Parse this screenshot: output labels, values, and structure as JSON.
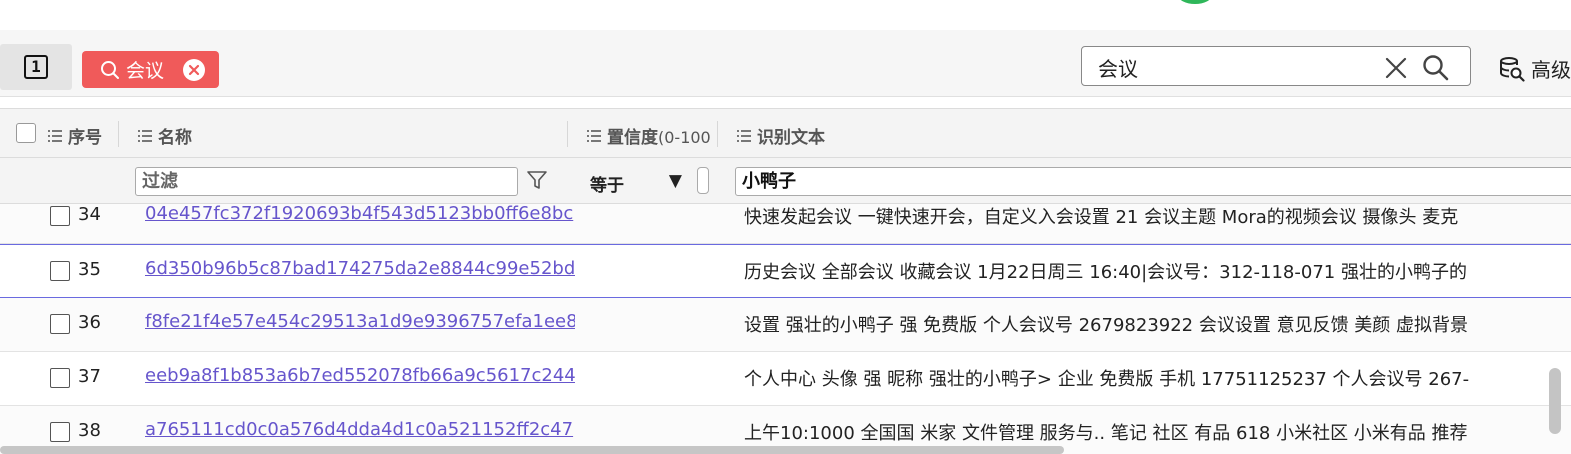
{
  "toolbar": {
    "count_label": "1",
    "search_chip": {
      "label": "会议",
      "color": "#f05a5a"
    },
    "search": {
      "value": "会议"
    },
    "advanced_label": "高级"
  },
  "columns": {
    "seq": "序号",
    "name": "名称",
    "confidence": "置信度",
    "confidence_range": "(0-100",
    "text": "识别文本"
  },
  "filters": {
    "name_placeholder": "过滤",
    "confidence_operator": "等于",
    "text_value": "小鸭子"
  },
  "rows": [
    {
      "seq": "34",
      "name": "04e457fc372f1920693b4f543d5123bb0ff6e8bc",
      "text": "快速发起会议 一键快速开会，自定义入会设置 21 会议主题 Mora的视频会议 摄像头 麦克"
    },
    {
      "seq": "35",
      "name": "6d350b96b5c87bad174275da2e8844c99e52bd",
      "text": "历史会议 全部会议 收藏会议 1月22日周三 16:40|会议号：312-118-071 强壮的小鸭子的"
    },
    {
      "seq": "36",
      "name": "f8fe21f4e57e454c29513a1d9e9396757efa1ee8",
      "text": "设置 强壮的小鸭子 强 免费版 个人会议号 2679823922 会议设置 意见反馈 美颜 虚拟背景"
    },
    {
      "seq": "37",
      "name": "eeb9a8f1b853a6b7ed552078fb66a9c5617c244",
      "text": "个人中心 头像 强 昵称 强壮的小鸭子> 企业 免费版 手机 17751125237 个人会议号 267-"
    },
    {
      "seq": "38",
      "name": "a765111cd0c0a576d4dda4d1c0a521152ff2c47",
      "text": "上午10:1000 全国国 米家 文件管理 服务与.. 笔记 社区 有品 618 小米社区 小米有品 推荐"
    }
  ],
  "colors": {
    "link": "#6655cc",
    "selected_row_border": "#6a6ae0",
    "accent_green": "#2fb75a"
  }
}
